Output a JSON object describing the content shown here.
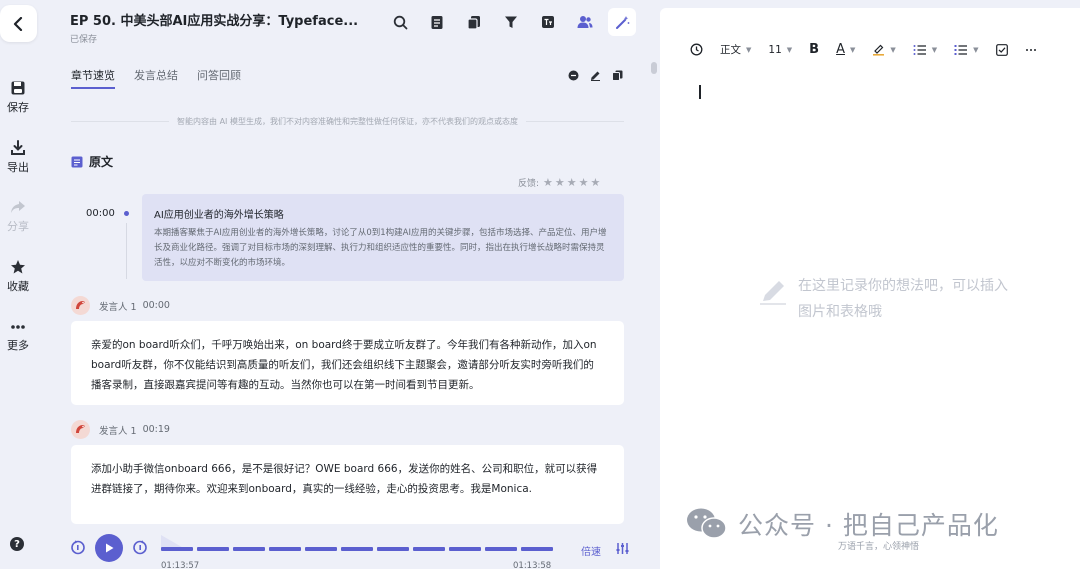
{
  "app": {
    "title": "EP 50. 中美头部AI应用实战分享：Typeface...",
    "save_status": "已保存"
  },
  "rail": {
    "items": [
      {
        "label": "保存",
        "icon": "save-icon"
      },
      {
        "label": "导出",
        "icon": "export-icon"
      },
      {
        "label": "分享",
        "icon": "share-icon"
      },
      {
        "label": "收藏",
        "icon": "star-icon"
      },
      {
        "label": "更多",
        "icon": "more-icon"
      }
    ],
    "help": "?"
  },
  "toolbar": {
    "icons": [
      "search-icon",
      "document-icon",
      "copy-icon",
      "filter-icon",
      "translate-icon",
      "speakers-icon",
      "magic-wand-icon"
    ]
  },
  "tabs": [
    {
      "label": "章节速览",
      "active": true
    },
    {
      "label": "发言总结",
      "active": false
    },
    {
      "label": "问答回顾",
      "active": false
    }
  ],
  "disclaimer": "智能内容由 AI 模型生成，我们不对内容准确性和完整性做任何保证，亦不代表我们的观点或态度",
  "section": {
    "title": "原文"
  },
  "feedback": {
    "label": "反馈:",
    "stars": "★★★★★"
  },
  "chapter": {
    "time": "00:00",
    "title": "AI应用创业者的海外增长策略",
    "description": "本期播客聚焦于AI应用创业者的海外增长策略，讨论了从0到1构建AI应用的关键步骤，包括市场选择、产品定位、用户增长及商业化路径。强调了对目标市场的深刻理解、执行力和组织适应性的重要性。同时，指出在执行增长战略时需保持灵活性，以应对不断变化的市场环境。"
  },
  "transcript": [
    {
      "speaker": "发言人 1",
      "time": "00:00",
      "text": "亲爱的on board听众们，千呼万唤始出来，on board终于要成立听友群了。今年我们有各种新动作，加入on board听友群，你不仅能结识到高质量的听友们，我们还会组织线下主题聚会，邀请部分听友实时旁听我们的播客录制，直接跟嘉宾提问等有趣的互动。当然你也可以在第一时间看到节目更新。"
    },
    {
      "speaker": "发言人 1",
      "time": "00:19",
      "text": "添加小助手微信onboard 666，是不是很好记？OWE board 666，发送你的姓名、公司和职位，就可以获得进群链接了，期待你来。欢迎来到onboard，真实的一线经验，走心的投资思考。我是Monica."
    }
  ],
  "player": {
    "current_time": "01:13:57",
    "end_time": "01:13:58",
    "speed_label": "倍速"
  },
  "editor": {
    "toolbar": {
      "style": "正文",
      "size": "11",
      "bold": "B",
      "font_color": "A"
    },
    "placeholder": "在这里记录你的想法吧，可以插入图片和表格哦"
  },
  "watermark": {
    "text": "公众号 · 把自己产品化",
    "subtitle": "万语千言，心领神悟"
  },
  "colors": {
    "accent": "#5b5fcf",
    "chapter_bg": "#dfe1f4",
    "panel_bg": "#eef0f8"
  }
}
